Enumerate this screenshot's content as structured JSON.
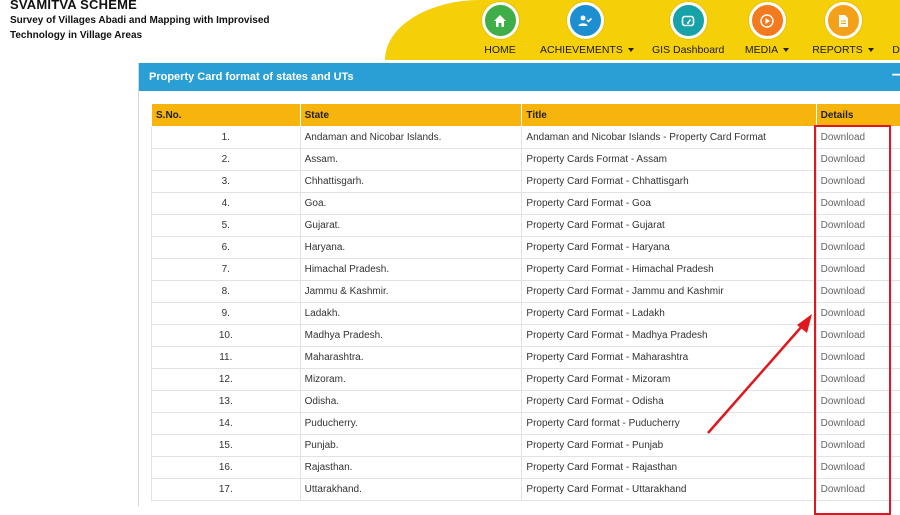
{
  "header": {
    "title": "SVAMITVA SCHEME",
    "subtitle": "Survey of Villages Abadi and Mapping with Improvised Technology in Village Areas"
  },
  "nav": [
    {
      "label": "HOME",
      "icon": "home-icon",
      "color": "#3fae49",
      "dropdown": false
    },
    {
      "label": "ACHIEVEMENTS",
      "icon": "user-check-icon",
      "color": "#1d8fd0",
      "dropdown": true
    },
    {
      "label": "GIS Dashboard",
      "icon": "dashboard-icon",
      "color": "#17a2a8",
      "dropdown": false
    },
    {
      "label": "MEDIA",
      "icon": "play-icon",
      "color": "#f47a20",
      "dropdown": true
    },
    {
      "label": "REPORTS",
      "icon": "document-icon",
      "color": "#f4a11a",
      "dropdown": true
    },
    {
      "label": "D",
      "icon": "",
      "color": "",
      "dropdown": false
    }
  ],
  "panel": {
    "title": "Property Card format of states and UTs",
    "toggle": "−"
  },
  "table": {
    "headers": [
      "S.No.",
      "State",
      "Title",
      "Details"
    ],
    "rows": [
      {
        "sn": "1.",
        "state": "Andaman and Nicobar Islands.",
        "title": "Andaman and Nicobar Islands - Property Card Format",
        "details": "Download"
      },
      {
        "sn": "2.",
        "state": "Assam.",
        "title": "Property Cards Format - Assam",
        "details": "Download"
      },
      {
        "sn": "3.",
        "state": "Chhattisgarh.",
        "title": "Property Card Format - Chhattisgarh",
        "details": "Download"
      },
      {
        "sn": "4.",
        "state": "Goa.",
        "title": "Property Card Format - Goa",
        "details": "Download"
      },
      {
        "sn": "5.",
        "state": "Gujarat.",
        "title": "Property Card Format - Gujarat",
        "details": "Download"
      },
      {
        "sn": "6.",
        "state": "Haryana.",
        "title": "Property Card Format - Haryana",
        "details": "Download"
      },
      {
        "sn": "7.",
        "state": "Himachal Pradesh.",
        "title": "Property Card Format - Himachal Pradesh",
        "details": "Download"
      },
      {
        "sn": "8.",
        "state": "Jammu & Kashmir.",
        "title": "Property Card Format - Jammu and Kashmir",
        "details": "Download"
      },
      {
        "sn": "9.",
        "state": "Ladakh.",
        "title": "Property Card Format - Ladakh",
        "details": "Download"
      },
      {
        "sn": "10.",
        "state": "Madhya Pradesh.",
        "title": "Property Card Format - Madhya Pradesh",
        "details": "Download"
      },
      {
        "sn": "11.",
        "state": "Maharashtra.",
        "title": "Property Card Format - Maharashtra",
        "details": "Download"
      },
      {
        "sn": "12.",
        "state": "Mizoram.",
        "title": "Property Card Format - Mizoram",
        "details": "Download"
      },
      {
        "sn": "13.",
        "state": "Odisha.",
        "title": "Property Card Format - Odisha",
        "details": "Download"
      },
      {
        "sn": "14.",
        "state": "Puducherry.",
        "title": "Property Card format - Puducherry",
        "details": "Download"
      },
      {
        "sn": "15.",
        "state": "Punjab.",
        "title": "Property Card Format - Punjab",
        "details": "Download"
      },
      {
        "sn": "16.",
        "state": "Rajasthan.",
        "title": "Property Card Format - Rajasthan",
        "details": "Download"
      },
      {
        "sn": "17.",
        "state": "Uttarakhand.",
        "title": "Property Card Format - Uttarakhand",
        "details": "Download"
      }
    ]
  },
  "annotation": {
    "highlight_color": "#e0171d"
  }
}
